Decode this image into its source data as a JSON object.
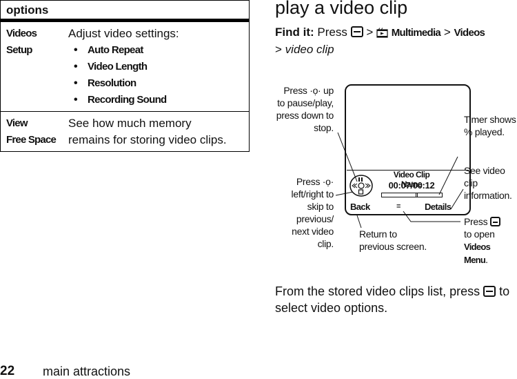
{
  "options_table": {
    "header": "options",
    "rows": [
      {
        "label_line1": "Videos",
        "label_line2": "Setup",
        "description": "Adjust video settings:",
        "bullets": [
          "Auto Repeat",
          "Video Length",
          "Resolution",
          "Recording Sound"
        ]
      },
      {
        "label_line1": "View",
        "label_line2": "Free Space",
        "description_line1": "See how much memory",
        "description_line2": "remains for storing video clips."
      }
    ]
  },
  "section": {
    "title": "play a video clip",
    "find_it": {
      "label": "Find it:",
      "press": "Press",
      "key_icon": "menu-key-icon",
      "sep": ">",
      "multimedia_icon": "multimedia-icon",
      "multimedia": "Multimedia",
      "videos": "Videos",
      "video_clip": "video clip"
    }
  },
  "phone_screen": {
    "clip_name": "Video Clip Name",
    "timer": "00:07/00:12",
    "progress_fraction": 0.58,
    "softkey_left": "Back",
    "menu_indicator": "≡",
    "softkey_right": "Details",
    "nav_icon": "navigation-control-icon"
  },
  "callouts": {
    "nav_up": [
      "Press",
      "up",
      "to pause/play,",
      "press down to",
      "stop."
    ],
    "nav_lr": [
      "Press",
      "left/right to",
      "skip to",
      "previous/",
      "next  video",
      "clip."
    ],
    "timer": [
      "Timer shows",
      "% played."
    ],
    "details": [
      "See video clip",
      "information."
    ],
    "back": [
      "Return to",
      "previous screen."
    ],
    "menu": {
      "press": "Press",
      "line2": "to open",
      "videos": "Videos",
      "menu": "Menu",
      "period": "."
    }
  },
  "bottom_paragraph": {
    "before": "From the stored video clips list, press",
    "after": "to select video options."
  },
  "footer": {
    "page_number": "22",
    "section_name": "main attractions"
  }
}
